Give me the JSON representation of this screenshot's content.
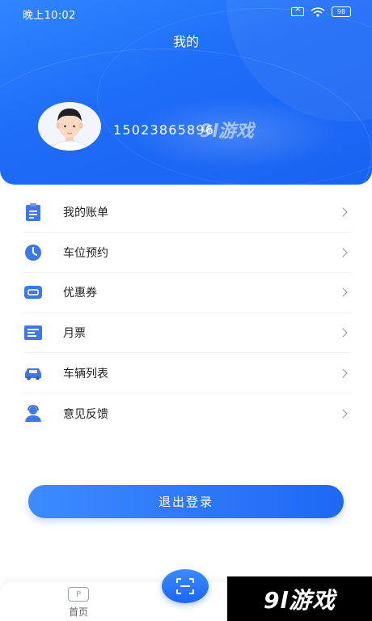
{
  "status_bar": {
    "time": "晚上10:02",
    "battery": "98",
    "icons": [
      "sim-off-icon",
      "wifi-icon",
      "battery-icon"
    ]
  },
  "header": {
    "title": "我的",
    "phone": "15023865896",
    "watermark": "9l游戏"
  },
  "menu": {
    "items": [
      {
        "label": "我的账单",
        "icon": "bill-icon"
      },
      {
        "label": "车位预约",
        "icon": "clock-icon"
      },
      {
        "label": "优惠券",
        "icon": "coupon-icon"
      },
      {
        "label": "月票",
        "icon": "monthly-ticket-icon"
      },
      {
        "label": "车辆列表",
        "icon": "car-icon"
      },
      {
        "label": "意见反馈",
        "icon": "feedback-icon"
      }
    ]
  },
  "logout_label": "退出登录",
  "tabbar": {
    "home_label": "首页",
    "home_icon_text": "P"
  },
  "brand": "9l游戏",
  "colors": {
    "primary": "#1e6cf7",
    "icon_blue": "#3d78e6",
    "text": "#222222",
    "chevron": "#8a8f99"
  }
}
